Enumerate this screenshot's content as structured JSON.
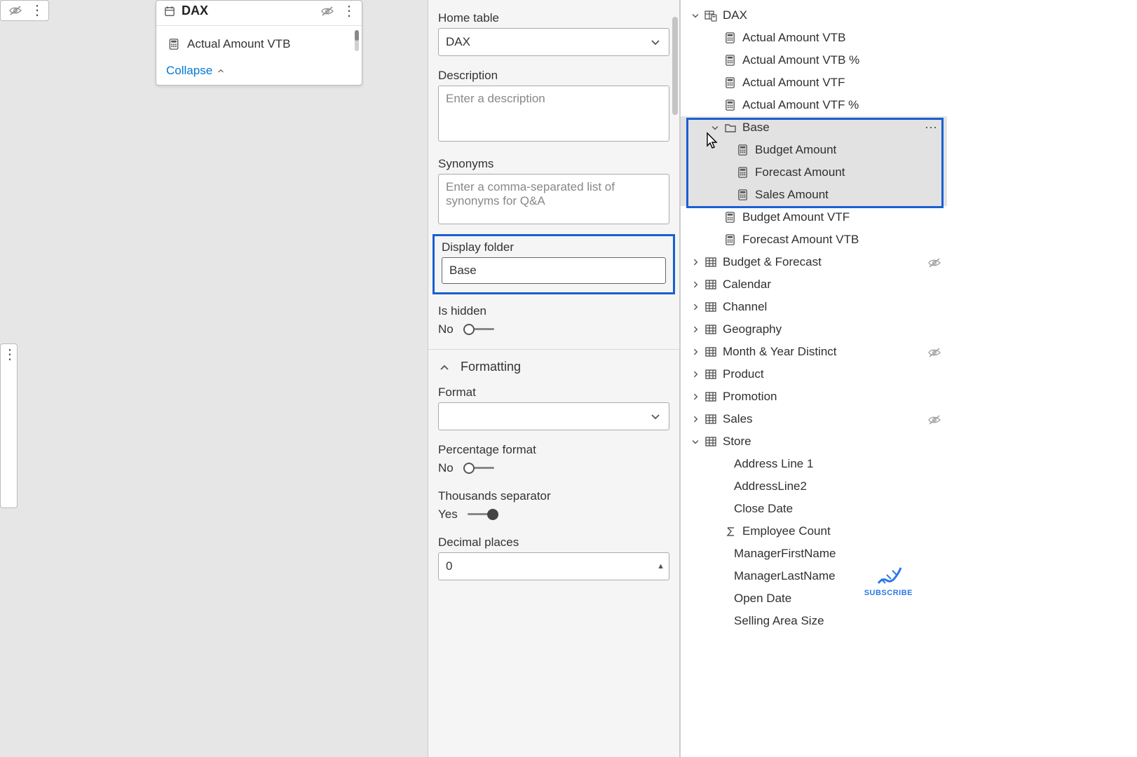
{
  "card": {
    "title": "DAX",
    "row1": "Actual Amount VTB",
    "collapse": "Collapse"
  },
  "props": {
    "home_table_label": "Home table",
    "home_table_value": "DAX",
    "description_label": "Description",
    "description_placeholder": "Enter a description",
    "synonyms_label": "Synonyms",
    "synonyms_placeholder": "Enter a comma-separated list of synonyms for Q&A",
    "display_folder_label": "Display folder",
    "display_folder_value": "Base",
    "is_hidden_label": "Is hidden",
    "is_hidden_state": "No",
    "formatting_header": "Formatting",
    "format_label": "Format",
    "format_value": "",
    "percentage_label": "Percentage format",
    "percentage_state": "No",
    "thousands_label": "Thousands separator",
    "thousands_state": "Yes",
    "decimal_label": "Decimal places",
    "decimal_value": "0"
  },
  "tree": {
    "dax": "DAX",
    "m1": "Actual Amount VTB",
    "m2": "Actual Amount VTB %",
    "m3": "Actual Amount VTF",
    "m4": "Actual Amount VTF %",
    "folder": "Base",
    "f1": "Budget Amount",
    "f2": "Forecast Amount",
    "f3": "Sales Amount",
    "m5": "Budget Amount VTF",
    "m6": "Forecast Amount VTB",
    "t1": "Budget & Forecast",
    "t2": "Calendar",
    "t3": "Channel",
    "t4": "Geography",
    "t5": "Month & Year Distinct",
    "t6": "Product",
    "t7": "Promotion",
    "t8": "Sales",
    "t9": "Store",
    "s1": "Address Line 1",
    "s2": "AddressLine2",
    "s3": "Close Date",
    "s4": "Employee Count",
    "s5": "ManagerFirstName",
    "s6": "ManagerLastName",
    "s7": "Open Date",
    "s8": "Selling Area Size"
  },
  "subscribe": "SUBSCRIBE"
}
